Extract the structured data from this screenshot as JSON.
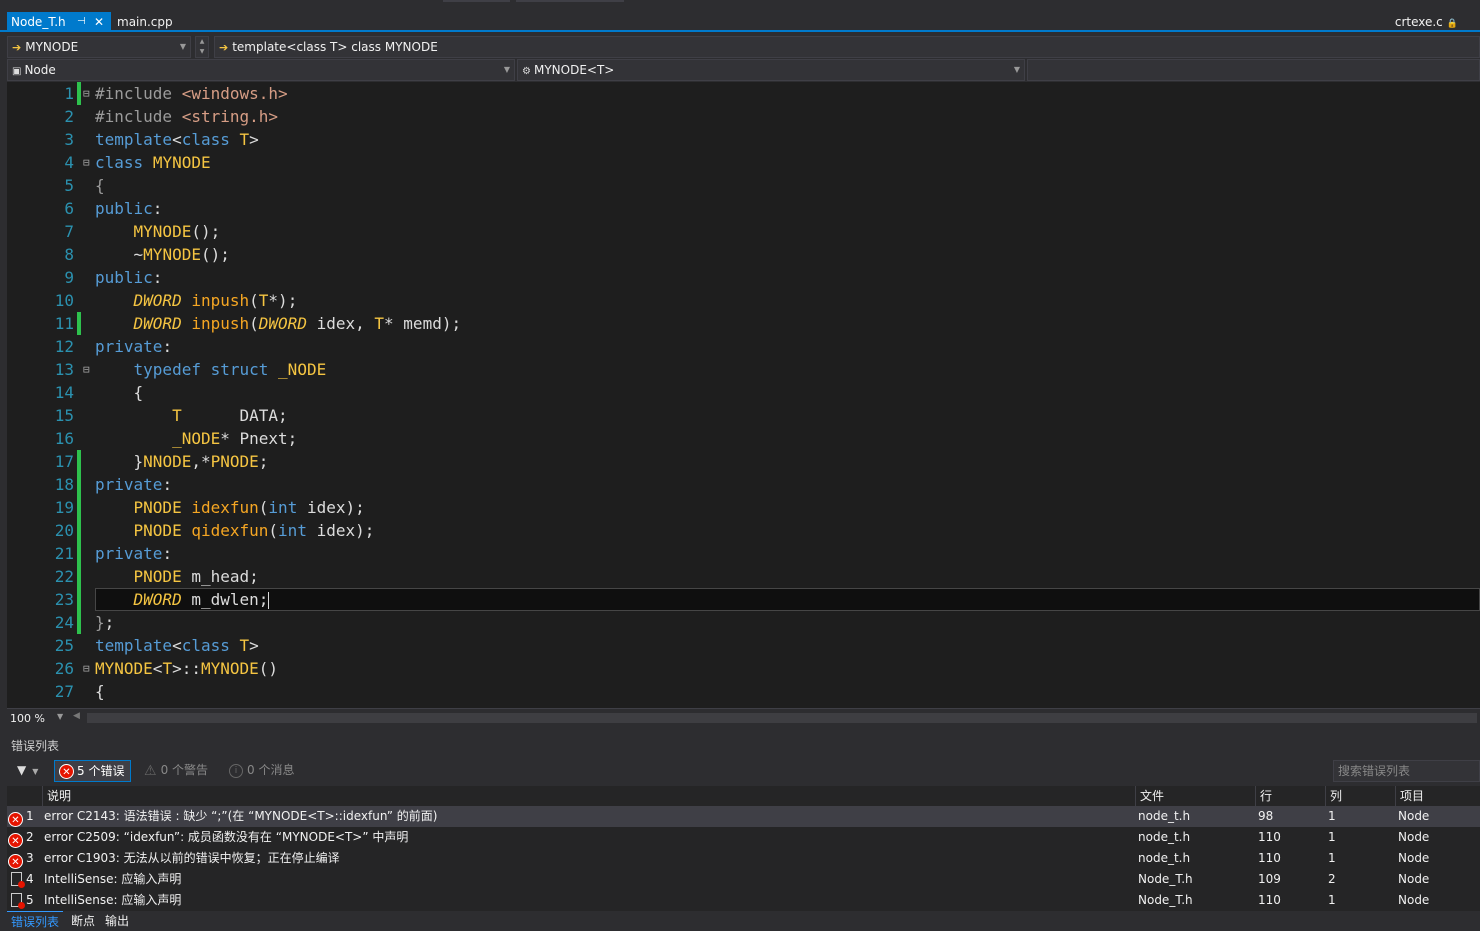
{
  "tabs": {
    "active": "Node_T.h",
    "inactive": "main.cpp",
    "right": "crtexe.c"
  },
  "nav": {
    "project_scope": "MYNODE",
    "member_scope": "template<class T> class MYNODE",
    "project": "Node",
    "class_scope": "MYNODE<T>"
  },
  "editor": {
    "zoom": "100 %",
    "line_numbers": [
      "1",
      "2",
      "3",
      "4",
      "5",
      "6",
      "7",
      "8",
      "9",
      "10",
      "11",
      "12",
      "13",
      "14",
      "15",
      "16",
      "17",
      "18",
      "19",
      "20",
      "21",
      "22",
      "23",
      "24",
      "25",
      "26",
      "27"
    ]
  },
  "error_list": {
    "title": "错误列表",
    "errors_btn": "5 个错误",
    "warnings_btn": "0 个警告",
    "messages_btn": "0 个消息",
    "search_placeholder": "搜索错误列表",
    "columns": {
      "desc": "说明",
      "file": "文件",
      "line": "行",
      "col": "列",
      "project": "项目"
    },
    "rows": [
      {
        "n": "1",
        "desc": "error C2143: 语法错误 : 缺少 “;”(在 “MYNODE<T>::idexfun” 的前面)",
        "file": "node_t.h",
        "line": "98",
        "col": "1",
        "project": "Node",
        "kind": "error"
      },
      {
        "n": "2",
        "desc": "error C2509: “idexfun”: 成员函数没有在 “MYNODE<T>” 中声明",
        "file": "node_t.h",
        "line": "110",
        "col": "1",
        "project": "Node",
        "kind": "error"
      },
      {
        "n": "3",
        "desc": "error C1903: 无法从以前的错误中恢复；正在停止编译",
        "file": "node_t.h",
        "line": "110",
        "col": "1",
        "project": "Node",
        "kind": "error"
      },
      {
        "n": "4",
        "desc": "IntelliSense:  应输入声明",
        "file": "Node_T.h",
        "line": "109",
        "col": "2",
        "project": "Node",
        "kind": "intellisense"
      },
      {
        "n": "5",
        "desc": "IntelliSense:  应输入声明",
        "file": "Node_T.h",
        "line": "110",
        "col": "1",
        "project": "Node",
        "kind": "intellisense"
      }
    ]
  },
  "bottom_tabs": [
    "错误列表",
    "断点",
    "输出"
  ],
  "colors": {
    "accent": "#007acc",
    "error": "#e51400",
    "change_marker": "#2ec14d"
  }
}
